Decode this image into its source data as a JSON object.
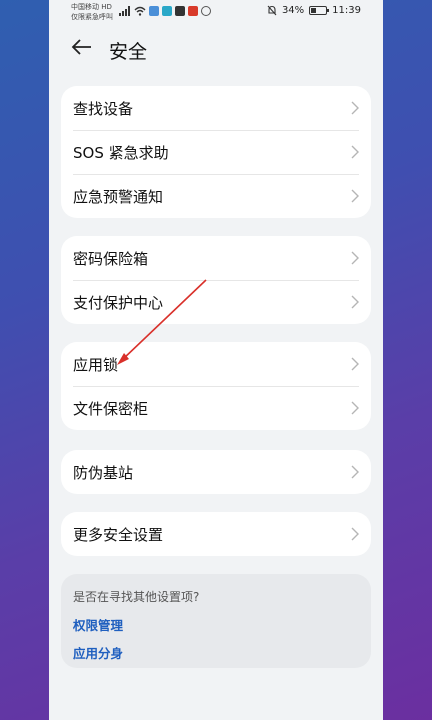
{
  "status_bar": {
    "carrier_line1": "中国移动 HD",
    "carrier_line2": "仅限紧急呼叫",
    "battery": "34%",
    "time": "11:39"
  },
  "header": {
    "title": "安全"
  },
  "groups": [
    {
      "items": [
        {
          "label": "查找设备"
        },
        {
          "label": "SOS 紧急求助"
        },
        {
          "label": "应急预警通知"
        }
      ]
    },
    {
      "items": [
        {
          "label": "密码保险箱"
        },
        {
          "label": "支付保护中心"
        }
      ]
    },
    {
      "items": [
        {
          "label": "应用锁"
        },
        {
          "label": "文件保密柜"
        }
      ]
    },
    {
      "items": [
        {
          "label": "防伪基站"
        }
      ]
    },
    {
      "items": [
        {
          "label": "更多安全设置"
        }
      ]
    }
  ],
  "hint": {
    "question": "是否在寻找其他设置项?",
    "links": [
      "权限管理",
      "应用分身"
    ]
  },
  "annotation_color": "#d9302a"
}
